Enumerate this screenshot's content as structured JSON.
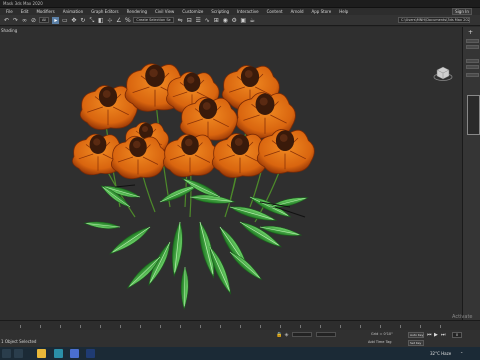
{
  "window": {
    "title": "Mask 3ds Max 2020"
  },
  "menu": {
    "items": [
      "File",
      "Edit",
      "Modifiers",
      "Animation",
      "Graph Editors",
      "Rendering",
      "Civil View",
      "Customize",
      "Scripting",
      "Interactive",
      "Content",
      "Arnold",
      "App Store",
      "Help"
    ],
    "signin": "Sign In"
  },
  "toolbar": {
    "filter_value": "All",
    "selection_set_value": "Create Selection Se",
    "project_path": "C:\\Users\\MNH\\Documents\\3ds Max 2020"
  },
  "viewport": {
    "label": "Shading"
  },
  "status": {
    "text": "1 Object Selected",
    "coord_x": "",
    "coord_y": "",
    "grid": "Grid = 0'10\"",
    "add_time_tag": "Add Time Tag",
    "auto_key": "Auto Key",
    "set_key": "Set Key",
    "frame": "0",
    "watermark": "Activate"
  },
  "taskbar": {
    "weather": "32°C  Haze"
  },
  "icons": [
    "select-icon",
    "link-icon",
    "unlink-icon",
    "move-icon",
    "rotate-icon",
    "scale-icon",
    "snap-icon",
    "mirror-icon",
    "align-icon",
    "render-icon",
    "viewcube-icon",
    "play-icon",
    "prev-frame-icon",
    "next-frame-icon",
    "windows-start-icon",
    "search-icon"
  ],
  "colors": {
    "petal": "#d9650f",
    "petal_dark": "#8a2e05",
    "center": "#3a1a0a",
    "leaf": "#3bb33e",
    "leaf_dark": "#1f7a22",
    "selection": "#5a7fa6"
  }
}
